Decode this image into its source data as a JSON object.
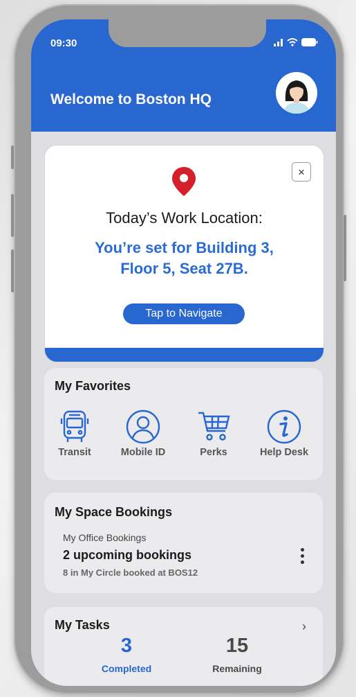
{
  "status_bar": {
    "time": "09:30"
  },
  "header": {
    "title": "Welcome to Boston HQ"
  },
  "location_card": {
    "title": "Today’s Work Location:",
    "detail_line1": "You’re set for Building 3,",
    "detail_line2": "Floor 5, Seat 27B.",
    "navigate_label": "Tap to Navigate",
    "close_glyph": "×"
  },
  "favorites": {
    "title": "My Favorites",
    "items": [
      {
        "label": "Transit",
        "icon": "bus-icon"
      },
      {
        "label": "Mobile ID",
        "icon": "user-icon"
      },
      {
        "label": "Perks",
        "icon": "cart-icon"
      },
      {
        "label": "Help Desk",
        "icon": "info-icon"
      }
    ]
  },
  "bookings": {
    "title": "My Space Bookings",
    "subtitle": "My Office Bookings",
    "summary": "2 upcoming bookings",
    "note": "8 in My Circle booked at BOS12"
  },
  "tasks": {
    "title": "My Tasks",
    "completed_count": "3",
    "completed_label": "Completed",
    "remaining_count": "15",
    "remaining_label": "Remaining",
    "chevron_glyph": "›"
  },
  "colors": {
    "brand_blue": "#2866d0",
    "pin_red": "#d4202a",
    "background": "#dedde2"
  }
}
